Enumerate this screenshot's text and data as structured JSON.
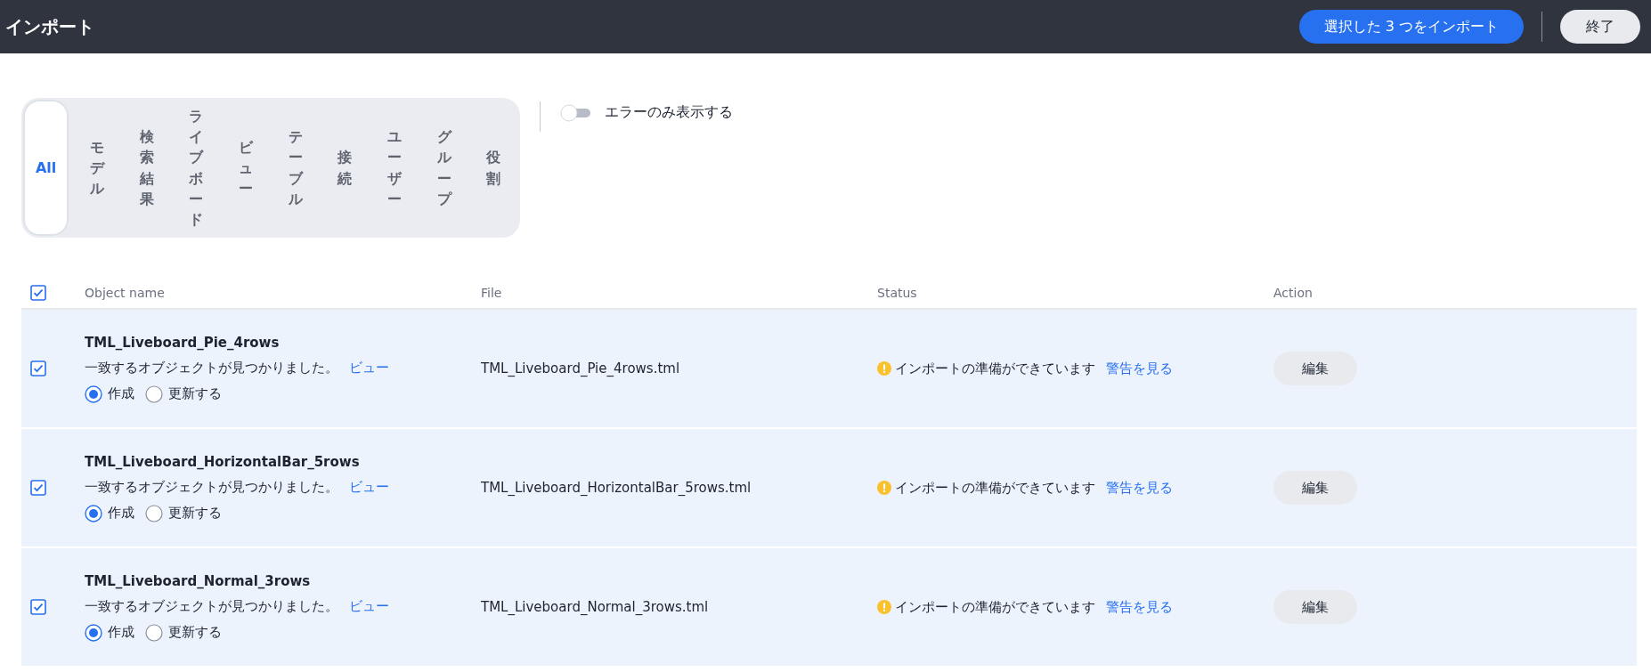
{
  "header": {
    "title": "インポート",
    "import_button": "選択した 3 つをインポート",
    "done_button": "終了"
  },
  "tabs": [
    {
      "label": "All",
      "selected": true
    },
    {
      "label": "モデル",
      "selected": false
    },
    {
      "label": "検索結果",
      "selected": false
    },
    {
      "label": "ライブボード",
      "selected": false
    },
    {
      "label": "ビュー",
      "selected": false
    },
    {
      "label": "テーブル",
      "selected": false
    },
    {
      "label": "接続",
      "selected": false
    },
    {
      "label": "ユーザー",
      "selected": false
    },
    {
      "label": "グループ",
      "selected": false
    },
    {
      "label": "役割",
      "selected": false
    }
  ],
  "error_toggle": {
    "label": "エラーのみ表示する",
    "on": false
  },
  "table": {
    "select_all": {
      "checked": true
    },
    "columns": [
      "Object name",
      "File",
      "Status",
      "Action"
    ],
    "rows": [
      {
        "checked": true,
        "name": "TML_Liveboard_Pie_4rows",
        "match_text": "一致するオブジェクトが見つかりました。",
        "view_link": "ビュー",
        "options": [
          {
            "label": "作成",
            "selected": true
          },
          {
            "label": "更新する",
            "selected": false
          }
        ],
        "file": "TML_Liveboard_Pie_4rows.tml",
        "status": "インポートの準備ができています",
        "warning_link": "警告を見る",
        "action": "編集"
      },
      {
        "checked": true,
        "name": "TML_Liveboard_HorizontalBar_5rows",
        "match_text": "一致するオブジェクトが見つかりました。",
        "view_link": "ビュー",
        "options": [
          {
            "label": "作成",
            "selected": true
          },
          {
            "label": "更新する",
            "selected": false
          }
        ],
        "file": "TML_Liveboard_HorizontalBar_5rows.tml",
        "status": "インポートの準備ができています",
        "warning_link": "警告を見る",
        "action": "編集"
      },
      {
        "checked": true,
        "name": "TML_Liveboard_Normal_3rows",
        "match_text": "一致するオブジェクトが見つかりました。",
        "view_link": "ビュー",
        "options": [
          {
            "label": "作成",
            "selected": true
          },
          {
            "label": "更新する",
            "selected": false
          }
        ],
        "file": "TML_Liveboard_Normal_3rows.tml",
        "status": "インポートの準備ができています",
        "warning_link": "警告を見る",
        "action": "編集"
      }
    ]
  }
}
